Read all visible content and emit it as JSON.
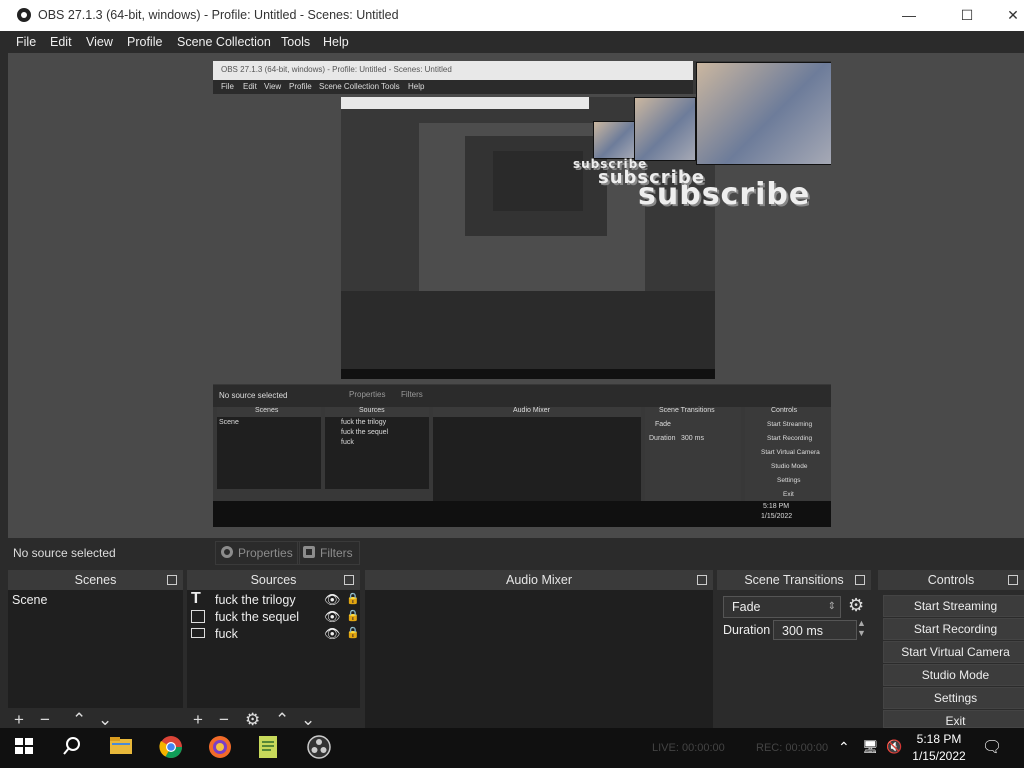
{
  "window": {
    "title": "OBS 27.1.3 (64-bit, windows) - Profile: Untitled - Scenes: Untitled",
    "controls": [
      "—",
      "☐",
      "✕"
    ]
  },
  "menu": [
    "File",
    "Edit",
    "View",
    "Profile",
    "Scene Collection",
    "Tools",
    "Help"
  ],
  "preview": {
    "nested_title": "OBS 27.1.3 (64-bit, windows) - Profile: Untitled - Scenes: Untitled",
    "nested_menu": [
      "File",
      "Edit",
      "View",
      "Profile",
      "Scene Collection",
      "Tools",
      "Help"
    ],
    "subscribe_text": "subscribe",
    "no_source": "No source selected",
    "properties": "Properties",
    "filters": "Filters",
    "scenes_title": "Scenes",
    "sources_title": "Sources",
    "mixer_title": "Audio Mixer",
    "transitions_title": "Scene Transitions",
    "controls_title": "Controls",
    "scene_item": "Scene",
    "source_items": [
      "fuck the trilogy",
      "fuck the sequel",
      "fuck"
    ],
    "fade": "Fade",
    "duration_label": "Duration",
    "duration_value": "300 ms",
    "controls": [
      "Start Streaming",
      "Start Recording",
      "Start Virtual Camera",
      "Studio Mode",
      "Settings",
      "Exit"
    ],
    "clock_time": "5:18 PM",
    "clock_date": "1/15/2022"
  },
  "source_bar": {
    "no_source": "No source selected",
    "properties": "Properties",
    "filters": "Filters"
  },
  "scenes": {
    "title": "Scenes",
    "items": [
      "Scene"
    ]
  },
  "sources": {
    "title": "Sources",
    "items": [
      {
        "name": "fuck the trilogy",
        "type": "text-icon"
      },
      {
        "name": "fuck the sequel",
        "type": "image-icon"
      },
      {
        "name": "fuck",
        "type": "display-icon"
      }
    ]
  },
  "mixer": {
    "title": "Audio Mixer"
  },
  "transitions": {
    "title": "Scene Transitions",
    "selected": "Fade",
    "duration_label": "Duration",
    "duration_value": "300 ms"
  },
  "controls": {
    "title": "Controls",
    "buttons": [
      "Start Streaming",
      "Start Recording",
      "Start Virtual Camera",
      "Studio Mode",
      "Settings",
      "Exit"
    ]
  },
  "status": {
    "live": "LIVE: 00:00:00",
    "rec": "REC: 00:00:00"
  },
  "taskbar": {
    "apps": [
      "start-icon",
      "search-icon",
      "file-explorer-icon",
      "chrome-icon",
      "brave-icon",
      "notepad-icon",
      "obs-icon"
    ],
    "time": "5:18 PM",
    "date": "1/15/2022"
  }
}
